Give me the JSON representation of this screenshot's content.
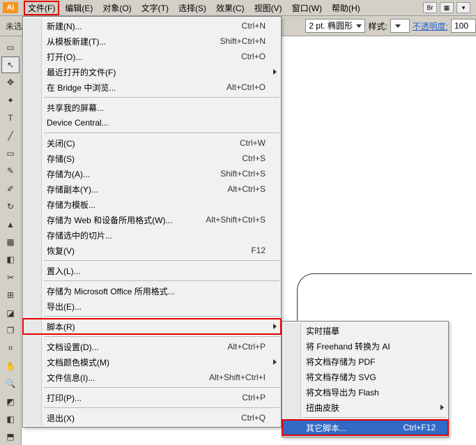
{
  "menubar": {
    "items": [
      "文件(F)",
      "编辑(E)",
      "对象(O)",
      "文字(T)",
      "选择(S)",
      "效果(C)",
      "视图(V)",
      "窗口(W)",
      "帮助(H)"
    ],
    "active_index": 0,
    "br_label": "Br",
    "grid_label": "▦",
    "dd_label": "▾"
  },
  "toolbar": {
    "left_label": "未选",
    "stroke_value": "2 pt. 椭圆形",
    "style_label": "样式:",
    "opacity_label": "不透明度:",
    "opacity_value": "100"
  },
  "tools": [
    "▭",
    "↖",
    "✥",
    "✦",
    "T",
    "╱",
    "▭",
    "✎",
    "✐",
    "↻",
    "▲",
    "▦",
    "◧",
    "✂",
    "⊞",
    "◪",
    "❐",
    "⌗",
    "✋",
    "🔍",
    "◩",
    "◧",
    "⬒"
  ],
  "file_menu": [
    {
      "label": "新建(N)...",
      "shortcut": "Ctrl+N"
    },
    {
      "label": "从模板新建(T)...",
      "shortcut": "Shift+Ctrl+N"
    },
    {
      "label": "打开(O)...",
      "shortcut": "Ctrl+O"
    },
    {
      "label": "最近打开的文件(F)",
      "arrow": true
    },
    {
      "label": "在 Bridge 中浏览...",
      "shortcut": "Alt+Ctrl+O"
    },
    {
      "sep": true
    },
    {
      "label": "共享我的屏幕..."
    },
    {
      "label": "Device Central..."
    },
    {
      "sep": true
    },
    {
      "label": "关闭(C)",
      "shortcut": "Ctrl+W"
    },
    {
      "label": "存储(S)",
      "shortcut": "Ctrl+S"
    },
    {
      "label": "存储为(A)...",
      "shortcut": "Shift+Ctrl+S"
    },
    {
      "label": "存储副本(Y)...",
      "shortcut": "Alt+Ctrl+S"
    },
    {
      "label": "存储为模板..."
    },
    {
      "label": "存储为 Web 和设备所用格式(W)...",
      "shortcut": "Alt+Shift+Ctrl+S"
    },
    {
      "label": "存储选中的切片..."
    },
    {
      "label": "恢复(V)",
      "shortcut": "F12"
    },
    {
      "sep": true
    },
    {
      "label": "置入(L)..."
    },
    {
      "sep": true
    },
    {
      "label": "存储为 Microsoft Office 所用格式..."
    },
    {
      "label": "导出(E)..."
    },
    {
      "sep": true
    },
    {
      "label": "脚本(R)",
      "arrow": true,
      "boxed": true
    },
    {
      "sep": true
    },
    {
      "label": "文档设置(D)...",
      "shortcut": "Alt+Ctrl+P"
    },
    {
      "label": "文档颜色模式(M)",
      "arrow": true
    },
    {
      "label": "文件信息(I)...",
      "shortcut": "Alt+Shift+Ctrl+I"
    },
    {
      "sep": true
    },
    {
      "label": "打印(P)...",
      "shortcut": "Ctrl+P"
    },
    {
      "sep": true
    },
    {
      "label": "退出(X)",
      "shortcut": "Ctrl+Q"
    }
  ],
  "script_menu": [
    {
      "label": "实时描摹"
    },
    {
      "label": "将 Freehand 转换为 AI"
    },
    {
      "label": "将文档存储为 PDF"
    },
    {
      "label": "将文档存储为 SVG"
    },
    {
      "label": "将文档导出为 Flash"
    },
    {
      "label": "扭曲皮肤",
      "arrow": true
    },
    {
      "sep": true
    },
    {
      "label": "其它脚本...",
      "shortcut": "Ctrl+F12",
      "hl": true,
      "boxed": true
    }
  ]
}
